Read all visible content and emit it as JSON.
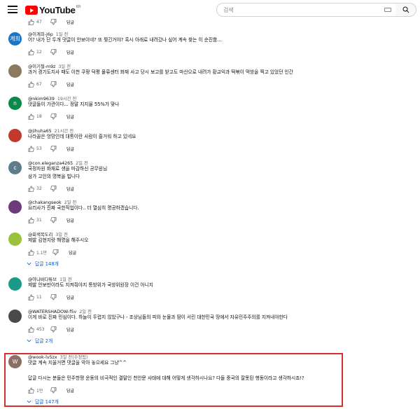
{
  "header": {
    "logo_text": "YouTube",
    "logo_region": "KR",
    "search_placeholder": "검색"
  },
  "top_partial": {
    "likes": "47",
    "reply_label": "답글"
  },
  "comments": [
    {
      "author": "@이계희-j6p",
      "time": "1일 전",
      "avatar_letter": "계희",
      "avatar_color": "#1a74c7",
      "text": "어? 내가 단 두개 댓글이 안보이네? 또 찢긴거야? 혹시 아래로 내려갔나 싶어 계속 찾는 이 순진함...",
      "likes": "12",
      "reply_label": "답글"
    },
    {
      "author": "@이기철-m9z",
      "time": "3일 전",
      "avatar_letter": "",
      "avatar_color": "#8a7a60",
      "text": "과거 경기도지사 때도 이천 쿠팡 덕평 물류센터 화재 사고 당시 보고를 받고도 마산으로 내려가 황교익과 떡볶이 먹방을 찍고 있었던 인간",
      "likes": "67",
      "reply_label": "답글"
    },
    {
      "author": "@nkim9639",
      "time": "19시간 전",
      "avatar_letter": "n",
      "avatar_color": "#0a8a4a",
      "text": "댓글들이 가관이다... 정말 지지율 55%가 맞나",
      "likes": "18",
      "reply_label": "답글"
    },
    {
      "author": "@jihuha65",
      "time": "21시간 전",
      "avatar_letter": "",
      "avatar_color": "#c0392b",
      "text": "나라꼴은 엉망인데 대통이란 사람이 즐거워 하고 있네요",
      "likes": "53",
      "reply_label": "답글"
    },
    {
      "author": "@con.eleganza4265",
      "time": "2일 전",
      "avatar_letter": "c",
      "avatar_color": "#5f7c8a",
      "text": "국정자원 화재로 생을 마감하신 공무원님\n삼가 고인의 명복을 빕니다",
      "likes": "32",
      "reply_label": "답글"
    },
    {
      "author": "@chakangseok",
      "time": "2일 전",
      "avatar_letter": "",
      "avatar_color": "#6d3b7a",
      "text": "요리사가 진짜 국한직업이다.. 더 열심히 명공하겠습니다.",
      "likes": "31",
      "reply_label": "답글"
    },
    {
      "author": "@회색목도리",
      "time": "3일 전",
      "avatar_letter": "",
      "avatar_color": "#9bc23c",
      "text": "제발 김현지랑 해명을 해주시오",
      "likes": "1.1만",
      "reply_label": "답글",
      "replies_label": "답글 148개"
    },
    {
      "author": "@아나바다튜브",
      "time": "1일 전",
      "avatar_letter": "",
      "avatar_color": "#1b9a8a",
      "text": "제발 안보만이라도 지켜줘야지 통방위가 국방위원장 이건 아니지",
      "likes": "11",
      "reply_label": "답글"
    },
    {
      "author": "@WATERSHADOW-f5v",
      "time": "2일 전",
      "avatar_letter": "",
      "avatar_color": "#4a4a4a",
      "text": "이게 바로 진짜 민심이다. 하늘이 두렵지 않았구나 - 조상님들의 피와 눈물과 땀이 서린 대한민국 땅에서 자유민주주의를 지켜내야한다",
      "likes": "453",
      "reply_label": "답글",
      "replies_label": "답글 2개"
    },
    {
      "author": "@wook-lv5zx",
      "time": "3일 전(수정됨)",
      "avatar_letter": "W",
      "avatar_color": "#8d6e63",
      "text": "댓글 계속 지울거면 댓글을 막아 놓으세요 그냥^^\n \n답글 다시는 분들은 민주항쟁 운동의 비극적인 결말인 천안문 사태에 대해 어떻게 생각하시나요? 다들 중국의 잘못된 행동이라고 생각하시죠!?",
      "likes": "1만",
      "reply_label": "답글",
      "replies_label": "답글 147개"
    }
  ]
}
